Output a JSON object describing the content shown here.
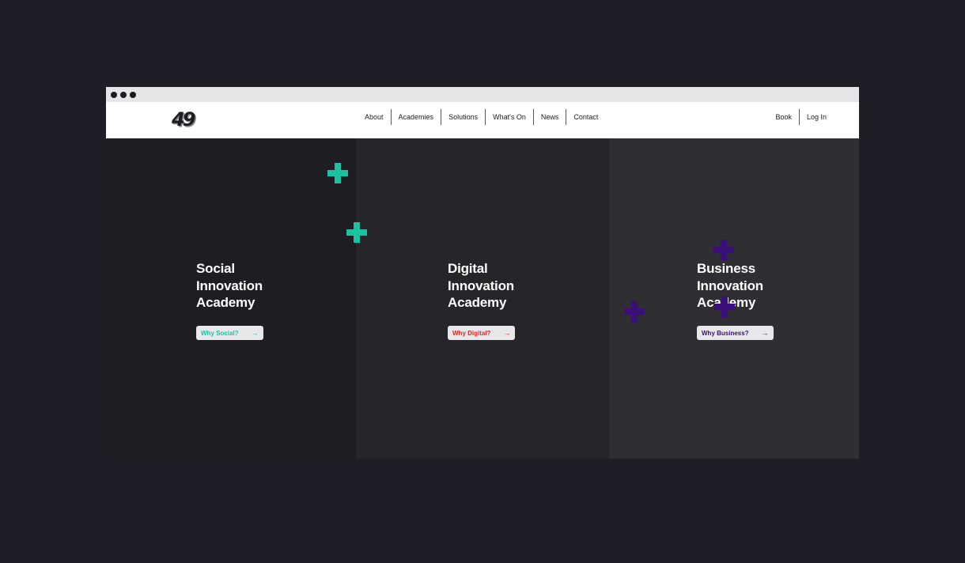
{
  "window": {
    "controls": [
      "close",
      "minimize",
      "maximize"
    ]
  },
  "brand": {
    "logo_text": "49"
  },
  "nav": {
    "links": [
      "About",
      "Academies",
      "Solutions",
      "What's On",
      "News",
      "Contact"
    ],
    "right": [
      "Book",
      "Log In"
    ]
  },
  "panels": [
    {
      "title_lines": [
        "Social",
        "Innovation",
        "Academy"
      ],
      "cta_label": "Why Social?",
      "cta_color": "#19c3a0",
      "accent_color": "#19c3a0"
    },
    {
      "title_lines": [
        "Digital",
        "Innovation",
        "Academy"
      ],
      "cta_label": "Why Digital?",
      "cta_color": "#e8251b",
      "accent_color": "#e8251b"
    },
    {
      "title_lines": [
        "Business",
        "Innovation",
        "Academy"
      ],
      "cta_label": "Why Business?",
      "cta_color": "#3a0f7a",
      "accent_color": "#3a0f7a"
    }
  ],
  "icons": {
    "cta_arrow": "arrow-right-icon",
    "decoration": "plus-icon"
  }
}
